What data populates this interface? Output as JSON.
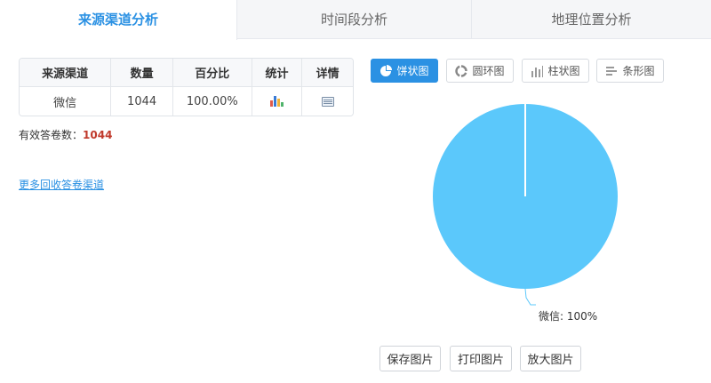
{
  "tabs": [
    {
      "label": "来源渠道分析",
      "active": true
    },
    {
      "label": "时间段分析",
      "active": false
    },
    {
      "label": "地理位置分析",
      "active": false
    }
  ],
  "table": {
    "headers": [
      "来源渠道",
      "数量",
      "百分比",
      "统计",
      "详情"
    ],
    "rows": [
      {
        "channel": "微信",
        "count": "1044",
        "percent": "100.00%"
      }
    ]
  },
  "summary": {
    "label": "有效答卷数：",
    "value": "1044"
  },
  "more_link": "更多回收答卷渠道",
  "chart_buttons": [
    {
      "label": "饼状图",
      "icon": "pie-icon",
      "active": true
    },
    {
      "label": "圆环图",
      "icon": "ring-icon",
      "active": false
    },
    {
      "label": "柱状图",
      "icon": "column-icon",
      "active": false
    },
    {
      "label": "条形图",
      "icon": "bar-icon",
      "active": false
    }
  ],
  "chart_data": {
    "type": "pie",
    "categories": [
      "微信"
    ],
    "values": [
      100
    ],
    "labels": [
      "微信: 100%"
    ],
    "colors": [
      "#5bc8fb"
    ]
  },
  "actions": [
    "保存图片",
    "打印图片",
    "放大图片"
  ],
  "colors": {
    "accent": "#2b91e3",
    "pie": "#5bc8fb",
    "highlight_number": "#c0392b"
  }
}
